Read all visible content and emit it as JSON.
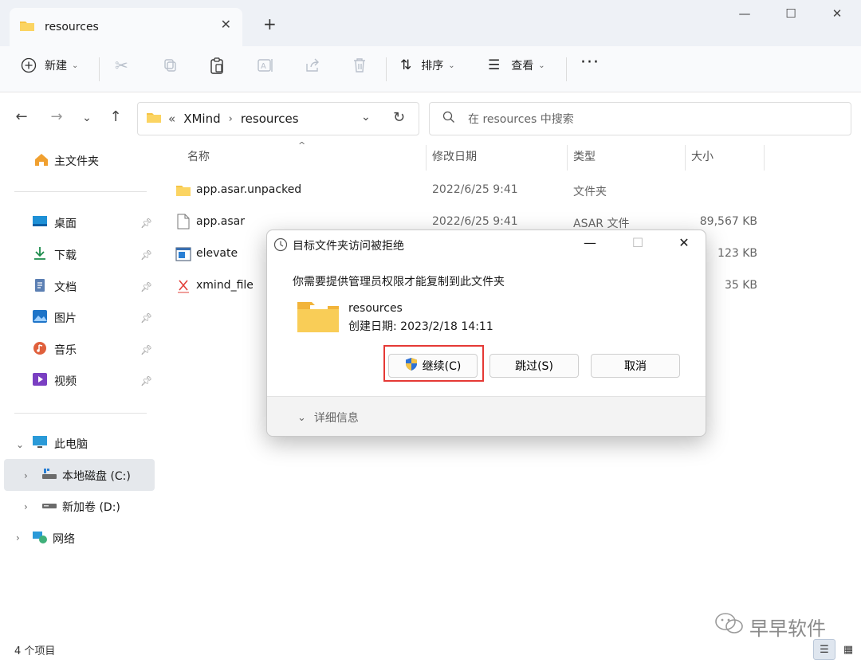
{
  "tab": {
    "title": "resources"
  },
  "toolbar": {
    "new_label": "新建",
    "sort_label": "排序",
    "view_label": "查看"
  },
  "address": {
    "crumb_prefix": "«",
    "path": [
      "XMind",
      "resources"
    ]
  },
  "search": {
    "placeholder": "在 resources 中搜索"
  },
  "sidebar": {
    "home": "主文件夹",
    "quick": [
      {
        "label": "桌面"
      },
      {
        "label": "下载"
      },
      {
        "label": "文档"
      },
      {
        "label": "图片"
      },
      {
        "label": "音乐"
      },
      {
        "label": "视频"
      }
    ],
    "this_pc": "此电脑",
    "drives": [
      {
        "label": "本地磁盘 (C:)"
      },
      {
        "label": "新加卷 (D:)"
      }
    ],
    "network": "网络"
  },
  "columns": {
    "name": "名称",
    "date": "修改日期",
    "type": "类型",
    "size": "大小"
  },
  "files": [
    {
      "name": "app.asar.unpacked",
      "date": "2022/6/25 9:41",
      "type": "文件夹",
      "size": ""
    },
    {
      "name": "app.asar",
      "date": "2022/6/25 9:41",
      "type": "ASAR 文件",
      "size": "89,567 KB"
    },
    {
      "name": "elevate",
      "date": "",
      "type": "",
      "size": "123 KB"
    },
    {
      "name": "xmind_file",
      "date": "",
      "type": "",
      "size": "35 KB"
    }
  ],
  "status": {
    "count": "4 个项目"
  },
  "watermark": "早早软件",
  "dialog": {
    "title": "目标文件夹访问被拒绝",
    "message": "你需要提供管理员权限才能复制到此文件夹",
    "folder_name": "resources",
    "created": "创建日期: 2023/2/18 14:11",
    "continue_label": "继续(C)",
    "skip_label": "跳过(S)",
    "cancel_label": "取消",
    "details_label": "详细信息"
  },
  "colors": {
    "folder": "#f6c445",
    "highlight": "#e53935",
    "accent": "#0067c0"
  }
}
